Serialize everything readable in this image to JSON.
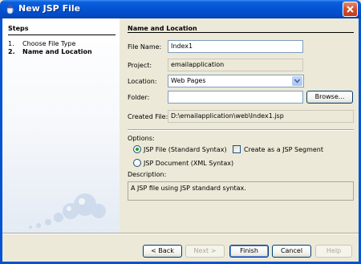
{
  "window": {
    "title": "New JSP File",
    "app_icon": "java-cup-icon",
    "close_icon": "close-icon"
  },
  "steps": {
    "heading": "Steps",
    "items": [
      {
        "number": "1.",
        "label": "Choose File Type",
        "active": false
      },
      {
        "number": "2.",
        "label": "Name and Location",
        "active": true
      }
    ]
  },
  "main": {
    "heading": "Name and Location",
    "file_name_label": "File Name:",
    "file_name_value": "Index1",
    "project_label": "Project:",
    "project_value": "emailapplication",
    "location_label": "Location:",
    "location_value": "Web Pages",
    "folder_label": "Folder:",
    "folder_value": "",
    "browse_label": "Browse...",
    "created_file_label": "Created File:",
    "created_file_value": "D:\\emailapplication\\web\\Index1.jsp",
    "options_label": "Options:",
    "option_jsp_file": "JSP File (Standard Syntax)",
    "option_jsp_document": "JSP Document (XML Syntax)",
    "option_segment": "Create as a JSP Segment",
    "description_label": "Description:",
    "description_text": "A JSP file using JSP standard syntax."
  },
  "buttons": {
    "back": "< Back",
    "next": "Next >",
    "finish": "Finish",
    "cancel": "Cancel",
    "help": "Help"
  },
  "colors": {
    "titlebar": "#0453d2",
    "window_bg": "#ece9d8",
    "radio_dot": "#21a121"
  }
}
